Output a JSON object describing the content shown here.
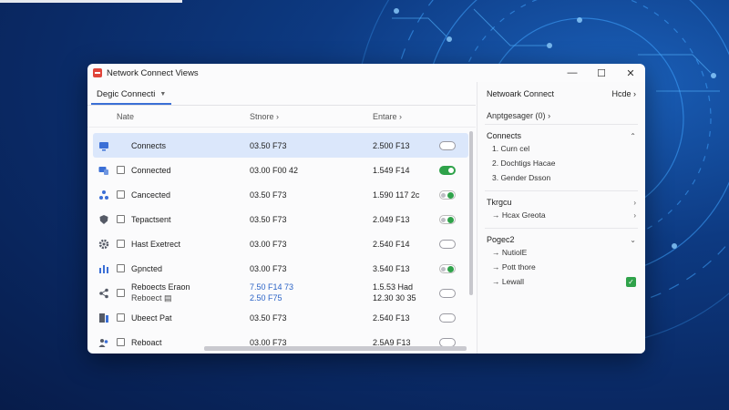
{
  "window": {
    "title": "Network Connect Views"
  },
  "tabs": [
    {
      "label": "Degic Connecti"
    }
  ],
  "columns": {
    "name": "Nate",
    "status": "Stnore",
    "entry": "Entare"
  },
  "rows": [
    {
      "name": "Connects",
      "status": "03.50 F73",
      "entry": "2.500 F13",
      "toggle": "off",
      "selected": true,
      "icon": "monitor-icon"
    },
    {
      "name": "Connected",
      "status": "03.00 F00 42",
      "entry": "1.549 F14",
      "toggle": "on",
      "selected": false,
      "icon": "devices-icon"
    },
    {
      "name": "Cancected",
      "status": "03.50 F73",
      "entry": "1.590 117 2c",
      "toggle": "dot",
      "selected": false,
      "icon": "nodes-icon"
    },
    {
      "name": "Tepactsent",
      "status": "03.50 F73",
      "entry": "2.049 F13",
      "toggle": "dot",
      "selected": false,
      "icon": "shield-icon"
    },
    {
      "name": "Hast Exetrect",
      "status": "03.00 F73",
      "entry": "2.540 F14",
      "toggle": "off",
      "selected": false,
      "icon": "gear-icon"
    },
    {
      "name": "Gpncted",
      "status": "03.00 F73",
      "entry": "3.540 F13",
      "toggle": "dot",
      "selected": false,
      "icon": "bars-icon"
    },
    {
      "name": "Reboects Eraon",
      "name2": "Reboect",
      "status": "7.50 F14 73",
      "status2": "2.50 F75",
      "entry": "1.5.53 Had",
      "entry2": "12.30 30 35",
      "toggle": "off",
      "selected": false,
      "icon": "share-icon"
    },
    {
      "name": "Ubeect Pat",
      "status": "03.50 F73",
      "entry": "2.540 F13",
      "toggle": "off",
      "selected": false,
      "icon": "doc-icon"
    },
    {
      "name": "Reboact",
      "status": "03.00 F73",
      "entry": "2.5A9 F13",
      "toggle": "off",
      "selected": false,
      "icon": "group-icon"
    }
  ],
  "right_panel": {
    "title": "Netwoark Connect",
    "hide_label": "Hcde",
    "subtitle": "Anptgesager (0)",
    "sections": [
      {
        "title": "Connects",
        "caret": "^",
        "items": [
          {
            "label": "1.  Curn cel"
          },
          {
            "label": "2.  Dochtigs Hacae"
          },
          {
            "label": "3.  Gender Dsson"
          }
        ]
      },
      {
        "title": "Tkrgcu",
        "caret": ">",
        "items": [
          {
            "label": "→  Hcax Greota",
            "caret": ">"
          }
        ]
      },
      {
        "title": "Pogec2",
        "caret": "v",
        "items": [
          {
            "label": "→  NutiolE"
          },
          {
            "label": "→  Pott thore"
          },
          {
            "label": "→  Lewall",
            "checked": true
          }
        ]
      }
    ]
  },
  "colors": {
    "accent": "#3b6fd6",
    "selected_row": "#dbe7fb",
    "toggle_on": "#2fa24a",
    "app_icon": "#e0453a"
  }
}
